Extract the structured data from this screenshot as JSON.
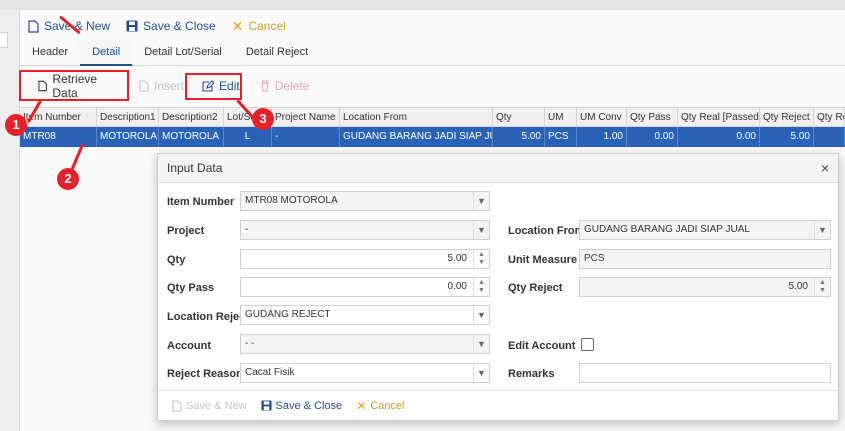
{
  "toolbar": {
    "save_new": "Save & New",
    "save_close": "Save & Close",
    "cancel": "Cancel"
  },
  "tabs": [
    {
      "label": "Header"
    },
    {
      "label": "Detail",
      "active": true
    },
    {
      "label": "Detail Lot/Serial"
    },
    {
      "label": "Detail Reject"
    }
  ],
  "detail_toolbar": {
    "retrieve": "Retrieve Data",
    "insert": "Insert",
    "edit": "Edit",
    "delete": "Delete"
  },
  "grid": {
    "columns": [
      "Item Number",
      "Description1",
      "Description2",
      "Lot/Se",
      "Project Name",
      "Location From",
      "Qty",
      "UM",
      "UM Conv",
      "Qty Pass",
      "Qty Real [Passed]",
      "Qty Reject",
      "Qty Re"
    ],
    "rows": [
      [
        "MTR08",
        "MOTOROLA",
        "MOTOROLA",
        "L",
        "-",
        "GUDANG BARANG JADI SIAP JUAL",
        "5.00",
        "PCS",
        "1.00",
        "0.00",
        "0.00",
        "5.00",
        ""
      ]
    ]
  },
  "annotations": [
    "1",
    "2",
    "3"
  ],
  "modal": {
    "title": "Input Data",
    "close_glyph": "×",
    "fields": {
      "item_number": {
        "label": "Item Number",
        "value": "MTR08 MOTOROLA"
      },
      "project": {
        "label": "Project",
        "value": "-"
      },
      "qty": {
        "label": "Qty",
        "value": "5.00"
      },
      "qty_pass": {
        "label": "Qty Pass",
        "value": "0.00"
      },
      "location_reject": {
        "label": "Location Reject",
        "value": "GUDANG REJECT"
      },
      "account": {
        "label": "Account",
        "value": "- -"
      },
      "reject_reason": {
        "label": "Reject Reason",
        "value": "Cacat Fisik"
      },
      "location_from": {
        "label": "Location From",
        "value": "GUDANG BARANG JADI SIAP JUAL"
      },
      "unit_measure": {
        "label": "Unit Measure",
        "value": "PCS"
      },
      "qty_reject": {
        "label": "Qty Reject",
        "value": "5.00"
      },
      "edit_account": {
        "label": "Edit Account",
        "checked": false
      },
      "remarks": {
        "label": "Remarks",
        "value": ""
      }
    },
    "footer": {
      "save_new": "Save & New",
      "save_close": "Save & Close",
      "cancel": "Cancel"
    }
  },
  "colors": {
    "accent": "#1f4e91",
    "selection": "#2a62b8",
    "annotation": "#e8202a",
    "cancel": "#c9a227"
  }
}
